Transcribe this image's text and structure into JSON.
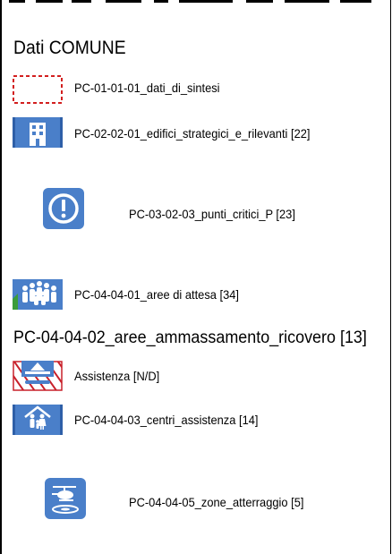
{
  "legend": {
    "group_title": "Dati COMUNE",
    "items": [
      {
        "label": "PC-01-01-01_dati_di_sintesi",
        "icon": "dashed-red-rectangle-icon"
      },
      {
        "label": "PC-02-02-01_edifici_strategici_e_rilevanti [22]",
        "icon": "building-icon"
      },
      {
        "label": "PC-03-02-03_punti_critici_P [23]",
        "icon": "exclamation-icon"
      },
      {
        "label": "PC-04-04-01_aree di attesa [34]",
        "icon": "people-group-icon"
      }
    ],
    "subgroup_title": "PC-04-04-02_aree_ammassamento_ricovero [13]",
    "subitems": [
      {
        "label": "Assistenza [N/D]",
        "icon": "shelter-hatched-icon"
      },
      {
        "label": "PC-04-04-03_centri_assistenza [14]",
        "icon": "family-house-icon"
      },
      {
        "label": "PC-04-04-05_zone_atterraggio [5]",
        "icon": "helicopter-icon"
      }
    ]
  },
  "colors": {
    "icon_blue": "#4a7fc9",
    "dashed_red": "#d21f1f",
    "hatch_red": "#c8202a"
  }
}
